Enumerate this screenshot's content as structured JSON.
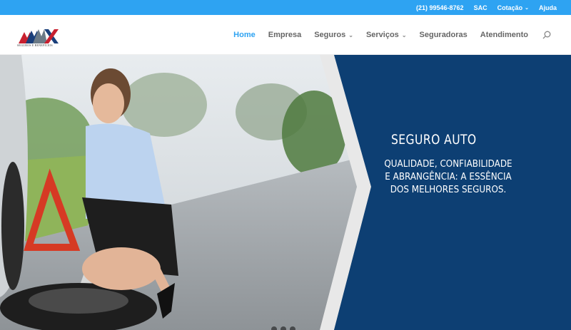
{
  "topbar": {
    "phone": "(21) 99546-8762",
    "sac": "SAC",
    "cotacao": "Cotação",
    "ajuda": "Ajuda"
  },
  "header": {
    "logo_text": "SEGUROS E BENEFÍCIOS",
    "nav": [
      {
        "label": "Home",
        "active": true,
        "dropdown": false
      },
      {
        "label": "Empresa",
        "active": false,
        "dropdown": false
      },
      {
        "label": "Seguros",
        "active": false,
        "dropdown": true
      },
      {
        "label": "Serviços",
        "active": false,
        "dropdown": true
      },
      {
        "label": "Seguradoras",
        "active": false,
        "dropdown": false
      },
      {
        "label": "Atendimento",
        "active": false,
        "dropdown": false
      }
    ]
  },
  "slide": {
    "title": "SEGURO AUTO",
    "description": "QUALIDADE, CONFIABILIDADE E ABRANGÊNCIA: A ESSÊNCIA DOS MELHORES SEGUROS."
  },
  "colors": {
    "accent": "#2ea3f2",
    "panel": "#0d3f73"
  },
  "icons": {
    "search": "search-icon",
    "chevron": "chevron-down-icon"
  }
}
